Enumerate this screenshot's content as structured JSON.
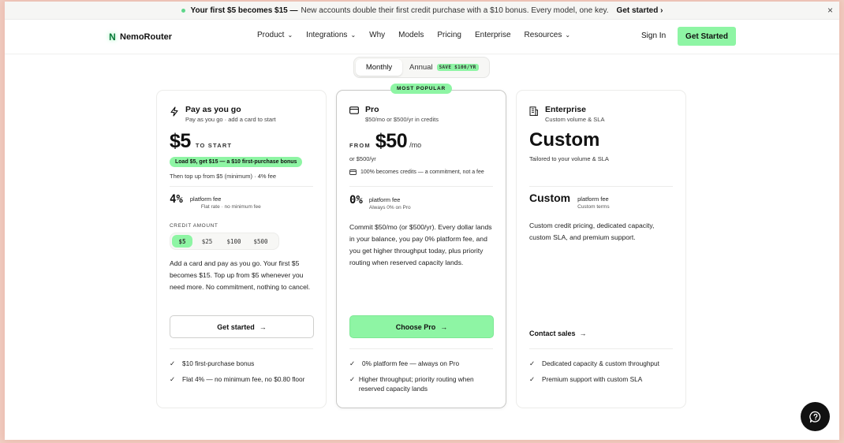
{
  "announcement": {
    "headline": "Your first $5 becomes $15 —",
    "text": "New accounts double their first credit purchase with a $10 bonus. Every model, one key.",
    "cta": "Get started ›",
    "close_icon": "×"
  },
  "nav": {
    "logo_mark": "N",
    "logo_text": "NemoRouter",
    "items": [
      {
        "label": "Product",
        "dropdown": true
      },
      {
        "label": "Integrations",
        "dropdown": true
      },
      {
        "label": "Why",
        "dropdown": false
      },
      {
        "label": "Models",
        "dropdown": false
      },
      {
        "label": "Pricing",
        "dropdown": false
      },
      {
        "label": "Enterprise",
        "dropdown": false
      },
      {
        "label": "Resources",
        "dropdown": true
      }
    ],
    "sign_in": "Sign In",
    "get_started": "Get Started"
  },
  "billing_toggle": {
    "monthly": "Monthly",
    "annual": "Annual",
    "save_badge": "SAVE $100/YR",
    "selected": "Monthly"
  },
  "plans": {
    "payg": {
      "title": "Pay as you go",
      "subtitle": "Pay as you go · add a card to start",
      "price": "$5",
      "price_suffix": "TO START",
      "bonus": "Load $5, get $15 — a $10 first-purchase bonus",
      "topup": "Then top up from $5 (minimum) · 4% fee",
      "fee": "4%",
      "fee_label": "platform fee",
      "fee_sub": "Flat rate · no minimum fee",
      "credit_label": "CREDIT AMOUNT",
      "amounts": [
        "$5",
        "$25",
        "$100",
        "$500"
      ],
      "selected_amount": "$5",
      "description": "Add a card and pay as you go. Your first $5 becomes $15. Top up from $5 whenever you need more. No commitment, nothing to cancel.",
      "button": "Get started",
      "features": [
        "$10 first-purchase bonus",
        "Flat 4% — no minimum fee, no $0.80 floor"
      ]
    },
    "pro": {
      "badge": "MOST POPULAR",
      "title": "Pro",
      "subtitle": "$50/mo or $500/yr in credits",
      "price_prefix": "FROM",
      "price": "$50",
      "per": "/mo",
      "alt_price": "or $500/yr",
      "credits_note": "100% becomes credits — a commitment, not a fee",
      "fee": "0%",
      "fee_label": "platform fee",
      "fee_sub": "Always 0% on Pro",
      "description": "Commit $50/mo (or $500/yr). Every dollar lands in your balance, you pay 0% platform fee, and you get higher throughput today, plus priority routing when reserved capacity lands.",
      "button": "Choose Pro",
      "features": [
        "0% platform fee — always on Pro",
        "Higher throughput; priority routing when reserved capacity lands"
      ]
    },
    "enterprise": {
      "title": "Enterprise",
      "subtitle": "Custom volume & SLA",
      "price": "Custom",
      "price_sub": "Tailored to your volume & SLA",
      "fee": "Custom",
      "fee_label": "platform fee",
      "fee_sub": "Custom terms",
      "description": "Custom credit pricing, dedicated capacity, custom SLA, and premium support.",
      "button": "Contact sales",
      "features": [
        "Dedicated capacity & custom throughput",
        "Premium support with custom SLA"
      ]
    }
  },
  "colors": {
    "accent_green": "#8ef5a4",
    "brand_green": "#0b7a3b",
    "text": "#111111",
    "border": "#ececea"
  },
  "icons": {
    "bolt": "bolt-icon",
    "card": "credit-card-icon",
    "building": "building-icon",
    "check": "check-icon",
    "arrow": "arrow-right-icon",
    "chat": "chat-help-icon"
  }
}
